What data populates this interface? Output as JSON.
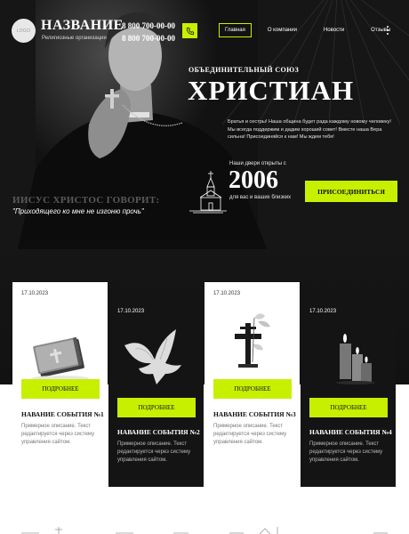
{
  "header": {
    "logo_text": "LOGO",
    "brand_title": "НАЗВАНИЕ",
    "brand_subtitle": "Религиозные организации",
    "phones": [
      "8 800 700-00-00",
      "8 800 700-00-00"
    ],
    "nav": [
      "Главная",
      "О компании",
      "Новости",
      "Отзывы"
    ],
    "active_nav": "Главная"
  },
  "hero": {
    "union_label": "ОБЪЕДИНИТЕЛЬНЫЙ СОЮЗ",
    "title": "ХРИСТИАН",
    "lead": "Братья и сестры! Наша община будет рада каждому новому человеку! Мы всегда поддержим и дадим хороший совет! Вместе наша Вера сильна! Присоединяйся к нам! Мы ждем тебя!",
    "open_since_label": "Наши двери открыты с",
    "year": "2006",
    "year_subtitle": "для вас и ваших близких",
    "join_button": "ПРИСОЕДИНИТЬСЯ",
    "jesus_says": "ИИСУС ХРИСТОС ГОВОРИТ:",
    "quote": "\"Приходящего ко мне не изгоню прочь\""
  },
  "events": [
    {
      "date": "17.10.2023",
      "button": "ПОДРОБНЕЕ",
      "title": "НАВАНИЕ СОБЫТИЯ №1",
      "description": "Примерное описание. Текст редактируется через систему управления сайтом.",
      "image": "bible-icon"
    },
    {
      "date": "17.10.2023",
      "button": "ПОДРОБНЕЕ",
      "title": "НАВАНИЕ СОБЫТИЯ №2",
      "description": "Примерное описание. Текст редактируется через систему управления сайтом.",
      "image": "dove-icon"
    },
    {
      "date": "17.10.2023",
      "button": "ПОДРОБНЕЕ",
      "title": "НАВАНИЕ СОБЫТИЯ №3",
      "description": "Примерное описание. Текст редактируется через систему управления сайтом.",
      "image": "cross-lily-icon"
    },
    {
      "date": "17.10.2023",
      "button": "ПОДРОБНЕЕ",
      "title": "НАВАНИЕ СОБЫТИЯ №4",
      "description": "Примерное описание. Текст редактируется через систему управления сайтом.",
      "image": "candles-icon"
    }
  ],
  "colors": {
    "accent": "#c6f000",
    "dark": "#121212",
    "card_dark": "#141414",
    "light": "#ffffff"
  }
}
